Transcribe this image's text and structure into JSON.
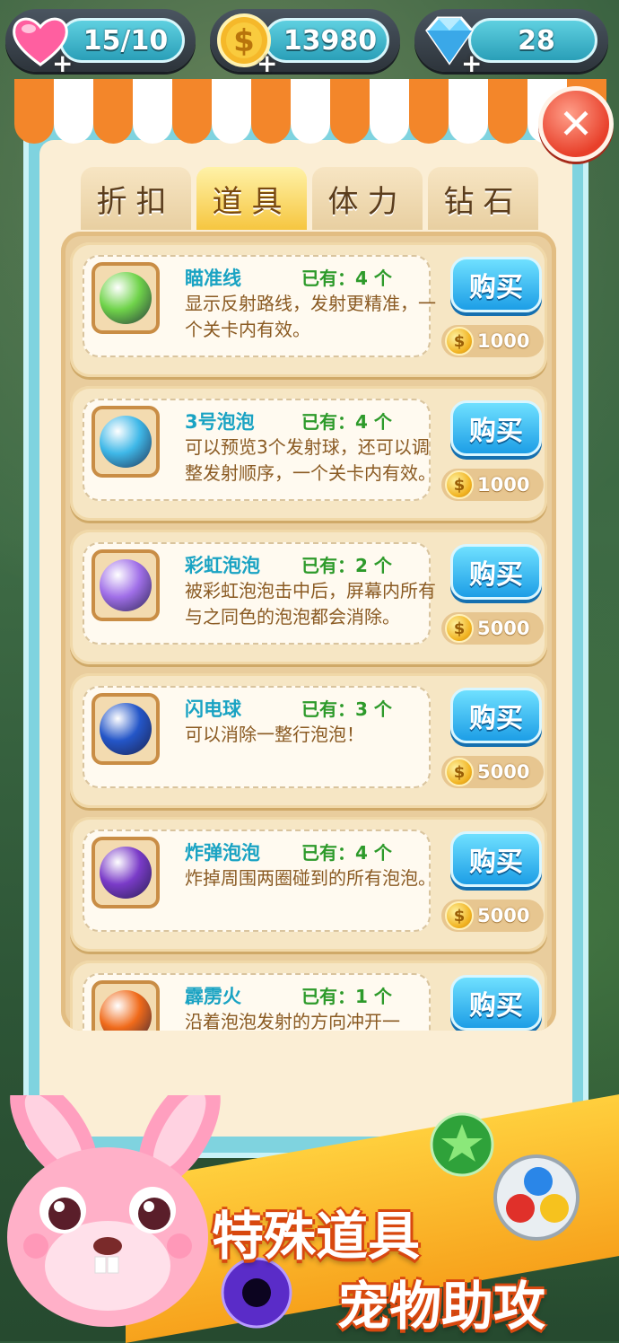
{
  "top_bar": {
    "lives": {
      "value": "15/10",
      "icon": "heart-icon",
      "color": "#ff5fa0"
    },
    "coins": {
      "value": "13980",
      "icon": "dollar-coin-icon",
      "color": "#f5b82a"
    },
    "gems": {
      "value": "28",
      "icon": "diamond-icon",
      "color": "#6fd3ff"
    },
    "plus": "+"
  },
  "close": {
    "glyph": "✕"
  },
  "tabs": [
    {
      "label": "折扣",
      "active": false
    },
    {
      "label": "道具",
      "active": true
    },
    {
      "label": "体力",
      "active": false
    },
    {
      "label": "钻石",
      "active": false
    }
  ],
  "items": [
    {
      "name": "瞄准线",
      "owned": "已有：4 个",
      "desc": "显示反射路线，发射更精准，一个关卡内有效。",
      "buy": "购买",
      "coin_glyph": "$",
      "price": "1000",
      "icon": "aim-line-icon",
      "color": "#6fd34a"
    },
    {
      "name": "3号泡泡",
      "owned": "已有：4 个",
      "desc": "可以预览3个发射球，还可以调整发射顺序，一个关卡内有效。",
      "buy": "购买",
      "coin_glyph": "$",
      "price": "1000",
      "icon": "three-bubbles-icon",
      "color": "#3fb8e8"
    },
    {
      "name": "彩虹泡泡",
      "owned": "已有：2 个",
      "desc": "被彩虹泡泡击中后，屏幕内所有与之同色的泡泡都会消除。",
      "buy": "购买",
      "coin_glyph": "$",
      "price": "5000",
      "icon": "rainbow-bubble-icon",
      "color": "#a06fe8"
    },
    {
      "name": "闪电球",
      "owned": "已有：3 个",
      "desc": "可以消除一整行泡泡！",
      "buy": "购买",
      "coin_glyph": "$",
      "price": "5000",
      "icon": "lightning-ball-icon",
      "color": "#2456c8"
    },
    {
      "name": "炸弹泡泡",
      "owned": "已有：4 个",
      "desc": "炸掉周围两圈碰到的所有泡泡。",
      "buy": "购买",
      "coin_glyph": "$",
      "price": "5000",
      "icon": "bomb-bubble-icon",
      "color": "#7a3bc8"
    },
    {
      "name": "霹雳火",
      "owned": "已有：1 个",
      "desc": "沿着泡泡发射的方向冲开一",
      "buy": "购买",
      "coin_glyph": "$",
      "price": "",
      "icon": "fire-ball-icon",
      "color": "#f06a1a"
    }
  ],
  "promo": {
    "line1": "特殊道具",
    "line2": "宠物助攻"
  }
}
